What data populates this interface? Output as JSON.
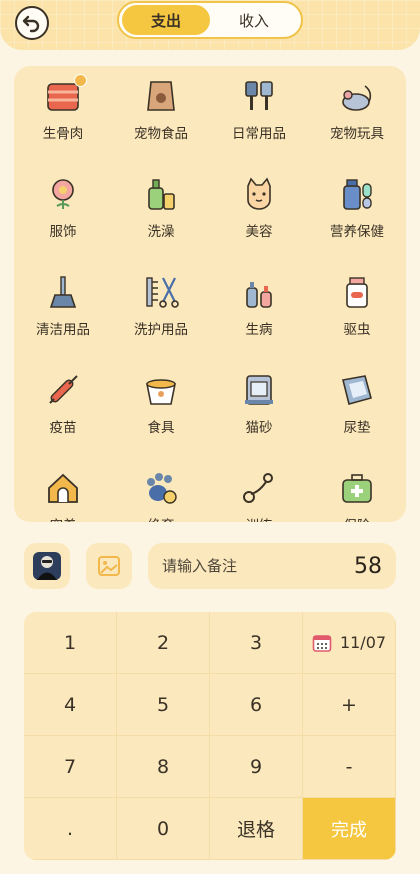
{
  "header": {
    "tabs": [
      {
        "label": "支出",
        "active": true
      },
      {
        "label": "收入",
        "active": false
      }
    ]
  },
  "categories": [
    {
      "label": "生骨肉",
      "icon": "raw-meat-icon"
    },
    {
      "label": "宠物食品",
      "icon": "pet-food-bag-icon"
    },
    {
      "label": "日常用品",
      "icon": "comb-brush-icon"
    },
    {
      "label": "宠物玩具",
      "icon": "toy-mouse-icon"
    },
    {
      "label": "服饰",
      "icon": "flower-bow-icon"
    },
    {
      "label": "洗澡",
      "icon": "shampoo-bottle-icon"
    },
    {
      "label": "美容",
      "icon": "cat-face-icon"
    },
    {
      "label": "营养保健",
      "icon": "vitamin-bottle-icon"
    },
    {
      "label": "清洁用品",
      "icon": "broom-icon"
    },
    {
      "label": "洗护用品",
      "icon": "comb-scissors-icon"
    },
    {
      "label": "生病",
      "icon": "medicine-bottles-icon"
    },
    {
      "label": "驱虫",
      "icon": "pill-bottle-icon"
    },
    {
      "label": "疫苗",
      "icon": "syringe-icon"
    },
    {
      "label": "食具",
      "icon": "food-bowl-icon"
    },
    {
      "label": "猫砂",
      "icon": "litter-box-icon"
    },
    {
      "label": "尿垫",
      "icon": "pee-pad-icon"
    },
    {
      "label": "宠着",
      "icon": "pet-house-icon"
    },
    {
      "label": "绝育",
      "icon": "paw-shield-icon"
    },
    {
      "label": "训练",
      "icon": "leash-icon"
    },
    {
      "label": "保险",
      "icon": "first-aid-kit-icon"
    }
  ],
  "note": {
    "placeholder": "请输入备注",
    "amount": "58"
  },
  "keypad": {
    "keys": [
      "1",
      "2",
      "3",
      "11/07",
      "4",
      "5",
      "6",
      "+",
      "7",
      "8",
      "9",
      "-",
      ".",
      "0",
      "退格",
      "完成"
    ]
  },
  "colors": {
    "accent": "#f5c63f",
    "panel": "#fbe8bd",
    "background": "#fdf5e4"
  }
}
